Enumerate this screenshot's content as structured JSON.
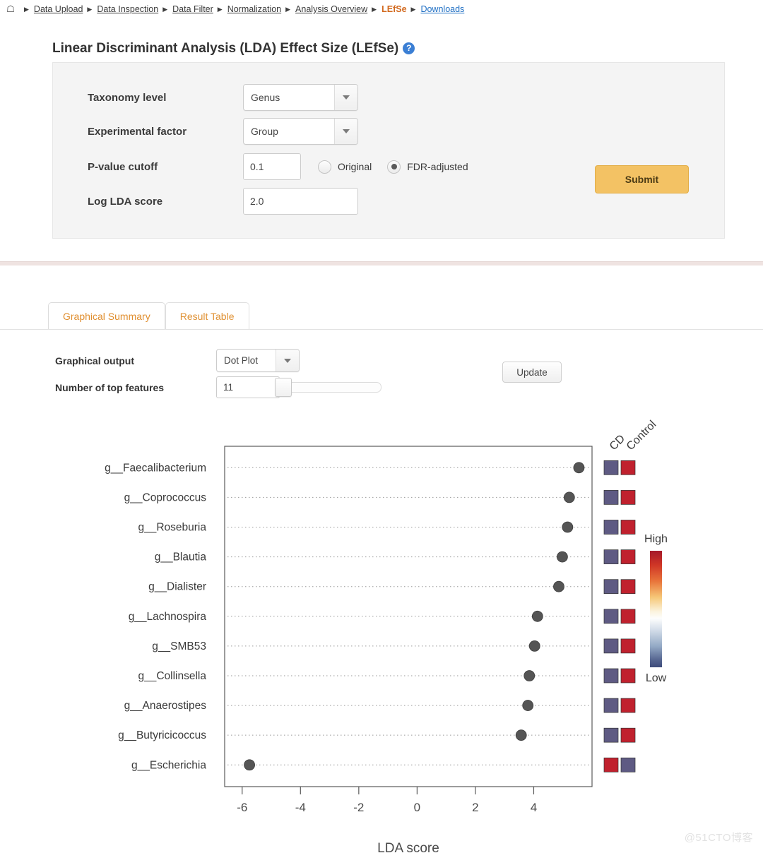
{
  "breadcrumb": {
    "home_icon": "home-icon",
    "items": [
      {
        "label": "Data Upload",
        "state": "link"
      },
      {
        "label": "Data Inspection",
        "state": "link"
      },
      {
        "label": "Data Filter",
        "state": "link"
      },
      {
        "label": "Normalization",
        "state": "link"
      },
      {
        "label": "Analysis Overview",
        "state": "link"
      },
      {
        "label": "LEfSe",
        "state": "active"
      },
      {
        "label": "Downloads",
        "state": "link-blue"
      }
    ]
  },
  "analysis": {
    "title": "Linear Discriminant Analysis (LDA) Effect Size (LEfSe)",
    "help_icon": "question-mark-icon",
    "fields": {
      "taxonomy_level_label": "Taxonomy level",
      "taxonomy_level_value": "Genus",
      "experimental_factor_label": "Experimental factor",
      "experimental_factor_value": "Group",
      "pvalue_label": "P-value cutoff",
      "pvalue_value": "0.1",
      "radio_original": "Original",
      "radio_fdr": "FDR-adjusted",
      "radio_selected": "FDR-adjusted",
      "lda_label": "Log LDA score",
      "lda_value": "2.0"
    },
    "submit_label": "Submit"
  },
  "results": {
    "tabs": [
      {
        "label": "Graphical Summary",
        "active": true
      },
      {
        "label": "Result Table",
        "active": false
      }
    ],
    "graphical_output_label": "Graphical output",
    "graphical_output_value": "Dot Plot",
    "top_features_label": "Number of top features",
    "top_features_value": "11",
    "update_label": "Update"
  },
  "watermark": "@51CTO博客",
  "chart_data": {
    "type": "scatter",
    "title": "",
    "xlabel": "LDA score",
    "ylabel": "",
    "xlim": [
      -6.6,
      6.0
    ],
    "xticks": [
      -6,
      -4,
      -2,
      0,
      2,
      4
    ],
    "xtick_labels": [
      "-6",
      "-4",
      "-2",
      "0",
      "2",
      "4"
    ],
    "grid": "horizontal-dotted",
    "categories": [
      "g__Faecalibacterium",
      "g__Coprococcus",
      "g__Roseburia",
      "g__Blautia",
      "g__Dialister",
      "g__Lachnospira",
      "g__SMB53",
      "g__Collinsella",
      "g__Anaerostipes",
      "g__Butyricicoccus",
      "g__Escherichia"
    ],
    "values": [
      5.55,
      5.22,
      5.16,
      4.98,
      4.86,
      4.13,
      4.03,
      3.85,
      3.8,
      3.57,
      -5.75
    ],
    "dot_color": "#555555",
    "heatmap": {
      "column_labels": [
        "CD",
        "Control"
      ],
      "rows": [
        {
          "category": "g__Faecalibacterium",
          "CD": "#5e5a83",
          "Control": "#c0212e"
        },
        {
          "category": "g__Coprococcus",
          "CD": "#5e5a83",
          "Control": "#c0212e"
        },
        {
          "category": "g__Roseburia",
          "CD": "#5e5a83",
          "Control": "#c0212e"
        },
        {
          "category": "g__Blautia",
          "CD": "#5e5a83",
          "Control": "#c0212e"
        },
        {
          "category": "g__Dialister",
          "CD": "#5e5a83",
          "Control": "#c0212e"
        },
        {
          "category": "g__Lachnospira",
          "CD": "#5e5a83",
          "Control": "#c0212e"
        },
        {
          "category": "g__SMB53",
          "CD": "#5e5a83",
          "Control": "#c0212e"
        },
        {
          "category": "g__Collinsella",
          "CD": "#5e5a83",
          "Control": "#c0212e"
        },
        {
          "category": "g__Anaerostipes",
          "CD": "#5e5a83",
          "Control": "#c0212e"
        },
        {
          "category": "g__Butyricicoccus",
          "CD": "#5e5a83",
          "Control": "#c0212e"
        },
        {
          "category": "g__Escherichia",
          "CD": "#c0212e",
          "Control": "#5e5a83"
        }
      ]
    },
    "colorbar": {
      "high_label": "High",
      "low_label": "Low",
      "stops": [
        "#a5192a",
        "#d94127",
        "#ef8a3c",
        "#f8cf7c",
        "#fbf6e4",
        "#ffffff",
        "#cfdbe8",
        "#8fa7c4",
        "#4f5f90",
        "#3d4a7a"
      ]
    }
  }
}
